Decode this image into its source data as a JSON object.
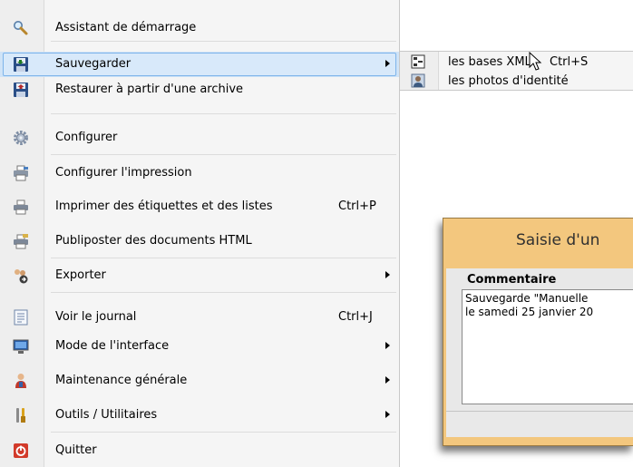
{
  "menu": {
    "items": [
      {
        "label": "Assistant de démarrage",
        "shortcut": "",
        "submenu": false,
        "icon": "magnifier-icon",
        "name": "menu-item-assistant"
      },
      {
        "label": "Sauvegarder",
        "shortcut": "",
        "submenu": true,
        "icon": "floppy-save-icon",
        "name": "menu-item-sauvegarder"
      },
      {
        "label": "Restaurer à partir d'une archive",
        "shortcut": "",
        "submenu": false,
        "icon": "floppy-restore-icon",
        "name": "menu-item-restaurer"
      },
      {
        "label": "Configurer",
        "shortcut": "",
        "submenu": false,
        "icon": "gear-icon",
        "name": "menu-item-configurer"
      },
      {
        "label": "Configurer l'impression",
        "shortcut": "",
        "submenu": false,
        "icon": "printer-settings-icon",
        "name": "menu-item-configurer-impression"
      },
      {
        "label": "Imprimer des étiquettes et des listes",
        "shortcut": "Ctrl+P",
        "submenu": false,
        "icon": "printer-icon",
        "name": "menu-item-imprimer"
      },
      {
        "label": "Publiposter des documents HTML",
        "shortcut": "",
        "submenu": false,
        "icon": "mail-merge-icon",
        "name": "menu-item-publiposter"
      },
      {
        "label": "Exporter",
        "shortcut": "",
        "submenu": true,
        "icon": "export-icon",
        "name": "menu-item-exporter"
      },
      {
        "label": "Voir le journal",
        "shortcut": "Ctrl+J",
        "submenu": false,
        "icon": "journal-icon",
        "name": "menu-item-journal"
      },
      {
        "label": "Mode de l'interface",
        "shortcut": "",
        "submenu": true,
        "icon": "monitor-icon",
        "name": "menu-item-mode-interface"
      },
      {
        "label": "Maintenance générale",
        "shortcut": "",
        "submenu": true,
        "icon": "maintenance-person-icon",
        "name": "menu-item-maintenance"
      },
      {
        "label": "Outils / Utilitaires",
        "shortcut": "",
        "submenu": true,
        "icon": "tools-icon",
        "name": "menu-item-outils"
      },
      {
        "label": "Quitter",
        "shortcut": "",
        "submenu": false,
        "icon": "power-icon",
        "name": "menu-item-quitter"
      }
    ]
  },
  "submenu": {
    "items": [
      {
        "label": "les bases XML",
        "shortcut": "Ctrl+S",
        "icon": "xml-database-icon"
      },
      {
        "label": "les photos d'identité",
        "shortcut": "",
        "icon": "id-photo-icon"
      }
    ]
  },
  "dialog": {
    "title": "Saisie d'un",
    "comment_label": "Commentaire",
    "comment_line1": "Sauvegarde \"Manuelle",
    "comment_line2": "le samedi 25 janvier 20"
  },
  "colors": {
    "highlight": "#cfe3f7",
    "dialog_title_bg": "#f3c77e"
  }
}
